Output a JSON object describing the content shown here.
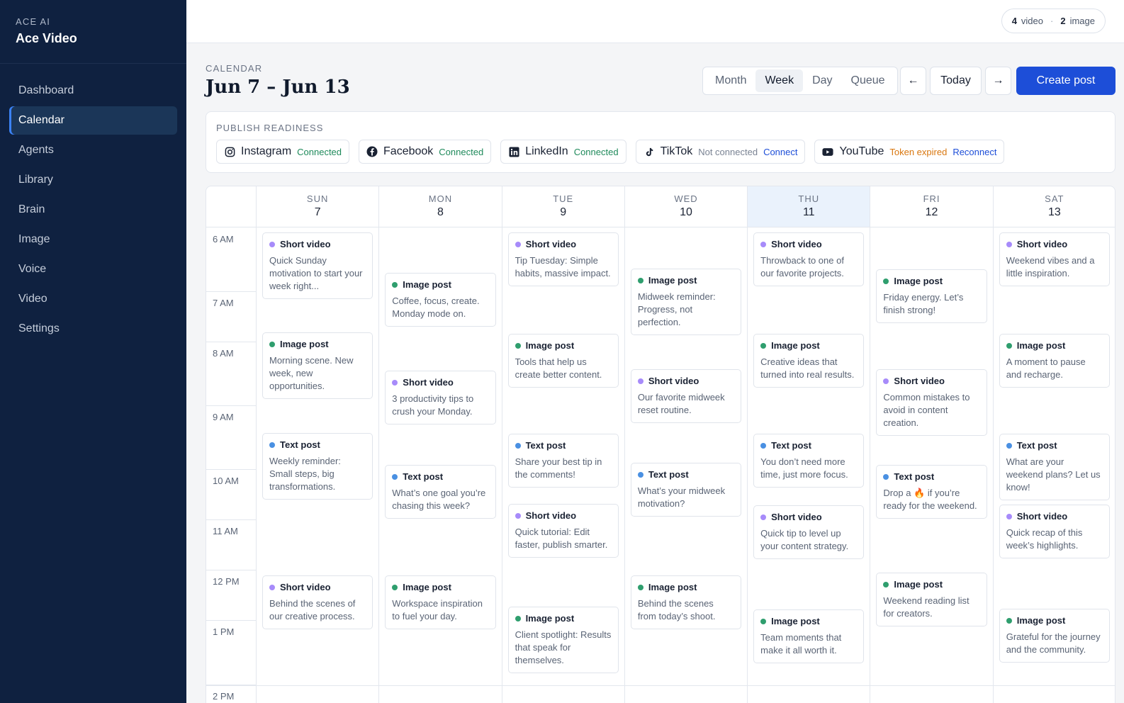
{
  "sidebar": {
    "brand_sub": "ACE AI",
    "brand_title": "Ace Video",
    "items": [
      "Dashboard",
      "Calendar",
      "Agents",
      "Library",
      "Brain",
      "Image",
      "Voice",
      "Video",
      "Settings"
    ],
    "active": "Calendar"
  },
  "topbar": {
    "video_count": "4",
    "video_label": "video",
    "image_count": "2",
    "image_label": "image"
  },
  "header": {
    "eyebrow": "CALENDAR",
    "title": "Jun 7 – Jun 13"
  },
  "views": [
    "Month",
    "Week",
    "Day",
    "Queue"
  ],
  "active_view": "Week",
  "nav": {
    "prev": "←",
    "today": "Today",
    "next": "→",
    "create": "Create post"
  },
  "readiness": {
    "label": "PUBLISH READINESS",
    "platforms": [
      {
        "name": "Instagram",
        "status": "Connected",
        "state": "ok",
        "action": "",
        "icon": "instagram-icon"
      },
      {
        "name": "Facebook",
        "status": "Connected",
        "state": "ok",
        "action": "",
        "icon": "facebook-icon"
      },
      {
        "name": "LinkedIn",
        "status": "Connected",
        "state": "ok",
        "action": "",
        "icon": "linkedin-icon"
      },
      {
        "name": "TikTok",
        "status": "Not connected",
        "state": "off",
        "action": "Connect",
        "icon": "tiktok-icon"
      },
      {
        "name": "YouTube",
        "status": "Token expired",
        "state": "warn",
        "action": "Reconnect",
        "icon": "youtube-icon"
      }
    ]
  },
  "calendar": {
    "today": "THU",
    "days": [
      {
        "name": "SUN",
        "num": "7"
      },
      {
        "name": "MON",
        "num": "8"
      },
      {
        "name": "TUE",
        "num": "9"
      },
      {
        "name": "WED",
        "num": "10"
      },
      {
        "name": "THU",
        "num": "11"
      },
      {
        "name": "FRI",
        "num": "12"
      },
      {
        "name": "SAT",
        "num": "13"
      }
    ],
    "hours": [
      "6 AM",
      "7 AM",
      "8 AM",
      "9 AM",
      "10 AM",
      "11 AM",
      "12 PM",
      "1 PM",
      "2 PM"
    ],
    "events": [
      {
        "day": 0,
        "kind": "video",
        "type": "Short video",
        "text": "Quick Sunday motivation to start your week right..."
      },
      {
        "day": 0,
        "kind": "image",
        "type": "Image post",
        "text": "Morning scene. New week, new opportunities."
      },
      {
        "day": 0,
        "kind": "text",
        "type": "Text post",
        "text": "Weekly reminder: Small steps, big transformations."
      },
      {
        "day": 0,
        "kind": "video",
        "type": "Short video",
        "text": "Behind the scenes of our creative process."
      },
      {
        "day": 1,
        "kind": "image",
        "type": "Image post",
        "text": "Coffee, focus, create. Monday mode on."
      },
      {
        "day": 1,
        "kind": "video",
        "type": "Short video",
        "text": "3 productivity tips to crush your Monday."
      },
      {
        "day": 1,
        "kind": "text",
        "type": "Text post",
        "text": "What’s one goal you’re chasing this week?"
      },
      {
        "day": 1,
        "kind": "image",
        "type": "Image post",
        "text": "Workspace inspiration to fuel your day."
      },
      {
        "day": 2,
        "kind": "video",
        "type": "Short video",
        "text": "Tip Tuesday: Simple habits, massive impact."
      },
      {
        "day": 2,
        "kind": "image",
        "type": "Image post",
        "text": "Tools that help us create better content."
      },
      {
        "day": 2,
        "kind": "text",
        "type": "Text post",
        "text": "Share your best tip in the comments!"
      },
      {
        "day": 2,
        "kind": "video",
        "type": "Short video",
        "text": "Quick tutorial: Edit faster, publish smarter."
      },
      {
        "day": 2,
        "kind": "image",
        "type": "Image post",
        "text": "Client spotlight: Results that speak for themselves."
      },
      {
        "day": 3,
        "kind": "image",
        "type": "Image post",
        "text": "Midweek reminder: Progress, not perfection."
      },
      {
        "day": 3,
        "kind": "video",
        "type": "Short video",
        "text": "Our favorite midweek reset routine."
      },
      {
        "day": 3,
        "kind": "text",
        "type": "Text post",
        "text": "What’s your midweek motivation?"
      },
      {
        "day": 3,
        "kind": "image",
        "type": "Image post",
        "text": "Behind the scenes from today’s shoot."
      },
      {
        "day": 4,
        "kind": "video",
        "type": "Short video",
        "text": "Throwback to one of our favorite projects."
      },
      {
        "day": 4,
        "kind": "image",
        "type": "Image post",
        "text": "Creative ideas that turned into real results."
      },
      {
        "day": 4,
        "kind": "text",
        "type": "Text post",
        "text": "You don’t need more time, just more focus."
      },
      {
        "day": 4,
        "kind": "video",
        "type": "Short video",
        "text": "Quick tip to level up your content strategy."
      },
      {
        "day": 4,
        "kind": "image",
        "type": "Image post",
        "text": "Team moments that make it all worth it."
      },
      {
        "day": 5,
        "kind": "image",
        "type": "Image post",
        "text": "Friday energy. Let’s finish strong!"
      },
      {
        "day": 5,
        "kind": "video",
        "type": "Short video",
        "text": "Common mistakes to avoid in content creation."
      },
      {
        "day": 5,
        "kind": "text",
        "type": "Text post",
        "text": "Drop a 🔥 if you’re ready for the weekend."
      },
      {
        "day": 5,
        "kind": "image",
        "type": "Image post",
        "text": "Weekend reading list for creators."
      },
      {
        "day": 6,
        "kind": "video",
        "type": "Short video",
        "text": "Weekend vibes and a little inspiration."
      },
      {
        "day": 6,
        "kind": "image",
        "type": "Image post",
        "text": "A moment to pause and recharge."
      },
      {
        "day": 6,
        "kind": "text",
        "type": "Text post",
        "text": "What are your weekend plans? Let us know!"
      },
      {
        "day": 6,
        "kind": "video",
        "type": "Short video",
        "text": "Quick recap of this week’s highlights."
      },
      {
        "day": 6,
        "kind": "image",
        "type": "Image post",
        "text": "Grateful for the journey and the community."
      }
    ]
  }
}
